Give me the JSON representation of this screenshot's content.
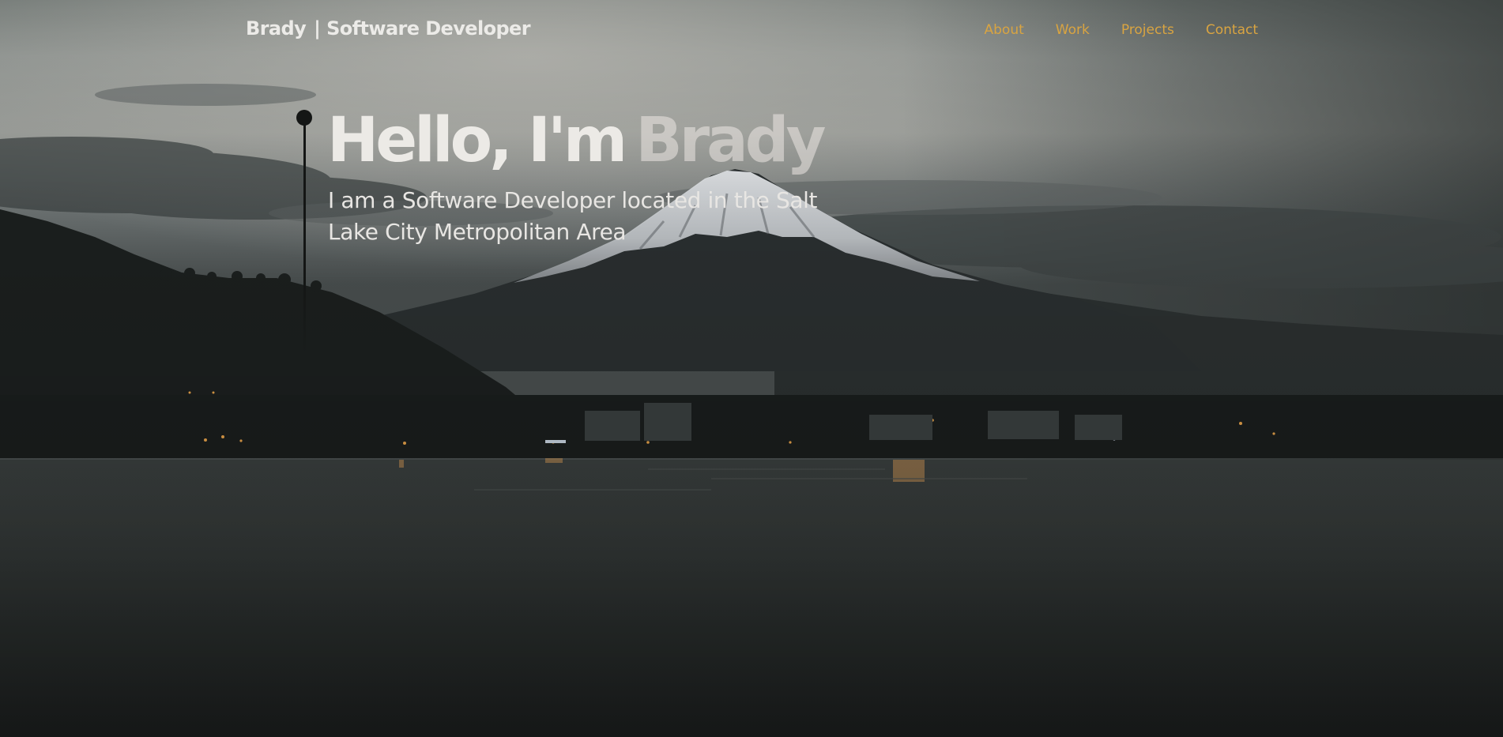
{
  "header": {
    "brand_name": "Brady",
    "brand_separator": "|",
    "brand_title": "Software Developer",
    "nav": [
      {
        "label": "About"
      },
      {
        "label": "Work"
      },
      {
        "label": "Projects"
      },
      {
        "label": "Contact"
      }
    ]
  },
  "hero": {
    "greeting": "Hello, I'm",
    "name": "Brady",
    "subtitle": "I am a Software Developer located in the Salt Lake City Metropolitan Area"
  },
  "colors": {
    "accent": "#d9a441",
    "text_primary": "#eceae6",
    "name_faded": "rgba(236,232,228,0.55)",
    "timeline": "#141615"
  },
  "background": {
    "scene": "mountain-lake-dusk"
  }
}
